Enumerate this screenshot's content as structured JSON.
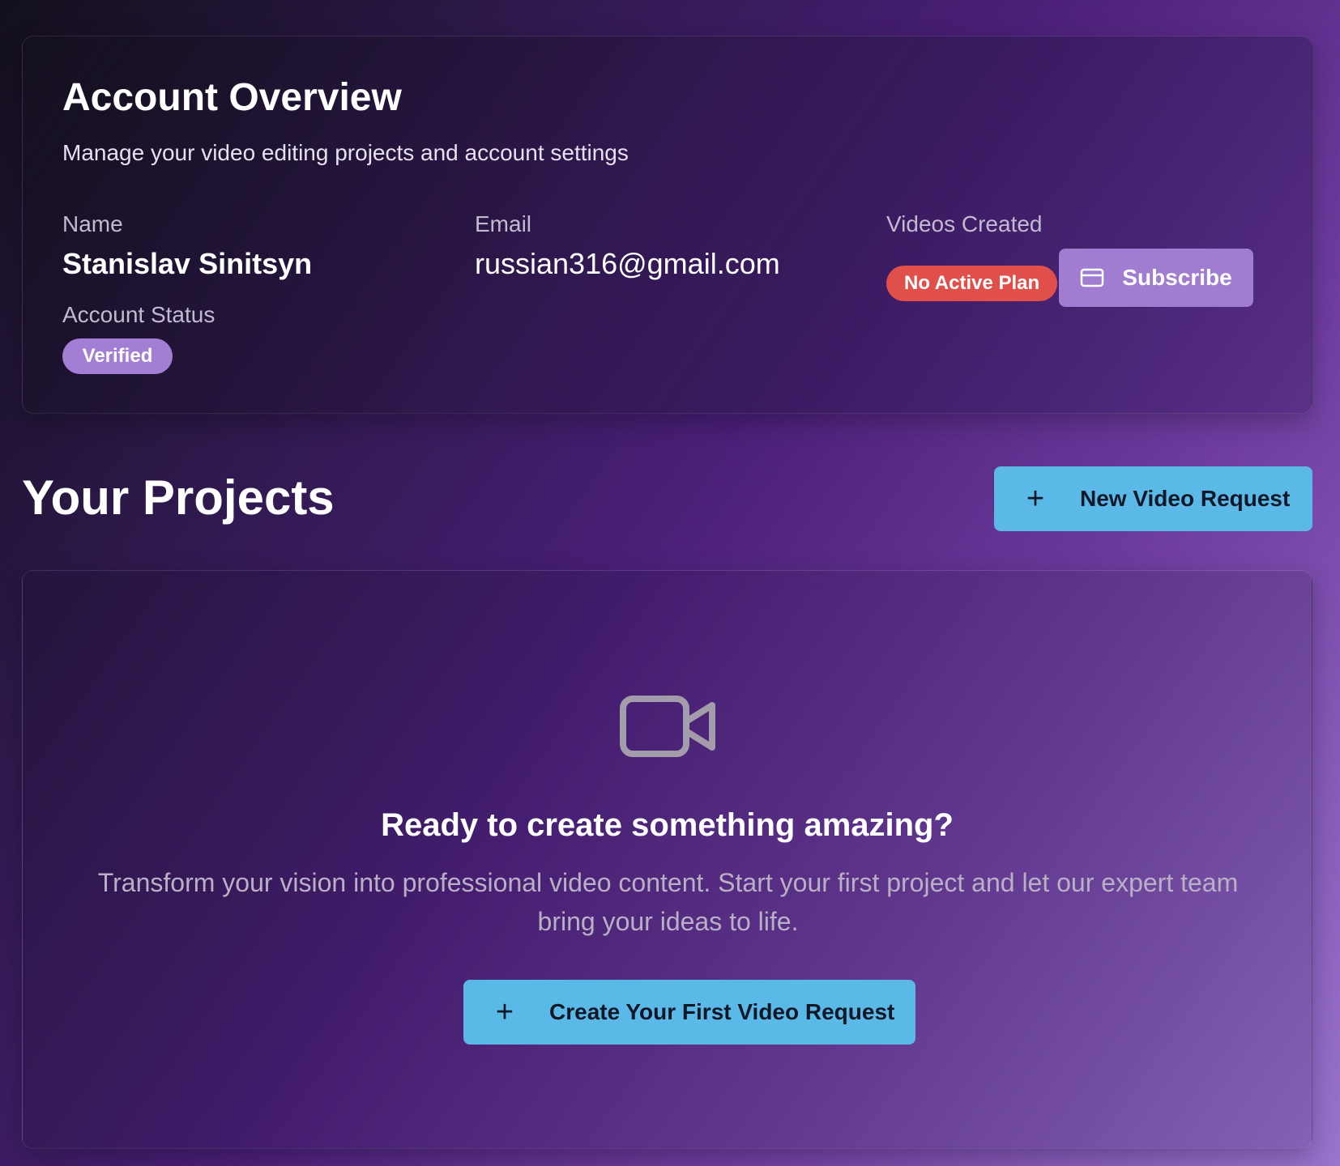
{
  "account": {
    "title": "Account Overview",
    "subtitle": "Manage your video editing projects and account settings",
    "name_label": "Name",
    "name_value": "Stanislav Sinitsyn",
    "email_label": "Email",
    "email_value": "russian316@gmail.com",
    "videos_label": "Videos Created",
    "plan_badge": "No Active Plan",
    "subscribe_label": "Subscribe",
    "status_label": "Account Status",
    "status_badge": "Verified"
  },
  "projects": {
    "title": "Your Projects",
    "new_button_label": "New Video Request",
    "empty_heading": "Ready to create something amazing?",
    "empty_description": "Transform your vision into professional video content. Start your first project and let our expert team bring your ideas to life.",
    "create_button_label": "Create Your First Video Request"
  },
  "icons": {
    "subscribe": "credit-card-icon",
    "add": "plus-icon",
    "empty_state": "video-camera-icon"
  },
  "colors": {
    "accent_blue": "#5bb9e8",
    "accent_purple": "#a07dd0",
    "danger_red": "#e14f4a",
    "muted_text": "#b9b0c6"
  }
}
